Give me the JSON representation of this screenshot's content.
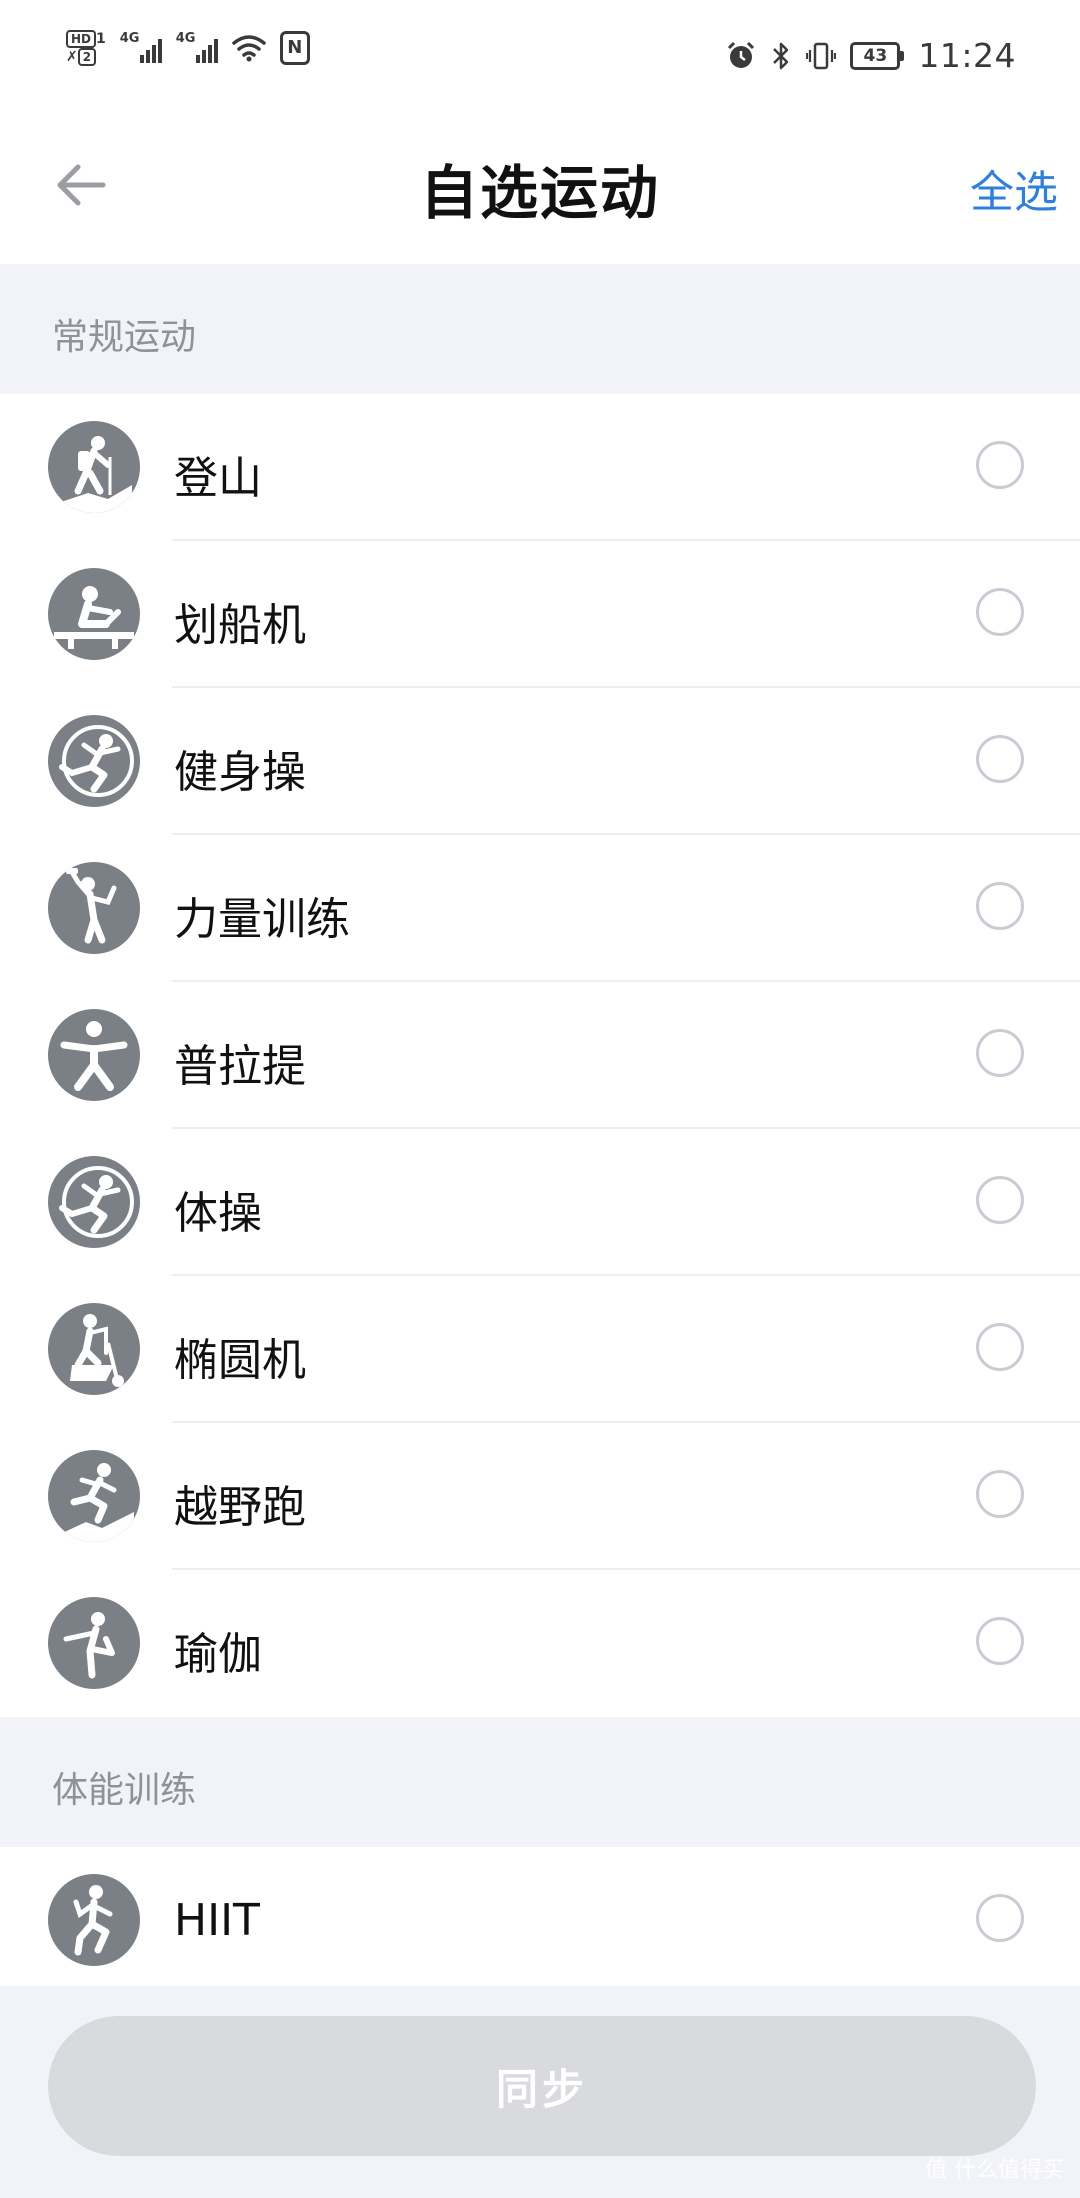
{
  "status_bar": {
    "time": "11:24",
    "battery_level": "43",
    "signal_1_tag": "4G",
    "signal_2_tag": "4G",
    "hd_label": "HD",
    "hd_slot_1": "1",
    "hd_slot_2": "2",
    "nfc_label": "N"
  },
  "app_bar": {
    "title": "自选运动",
    "select_all": "全选"
  },
  "sections": [
    {
      "header": "常规运动",
      "items": [
        {
          "label": "登山",
          "icon": "hiking-icon",
          "checked": false
        },
        {
          "label": "划船机",
          "icon": "rowing-machine-icon",
          "checked": false
        },
        {
          "label": "健身操",
          "icon": "aerobics-icon",
          "checked": false
        },
        {
          "label": "力量训练",
          "icon": "strength-training-icon",
          "checked": false
        },
        {
          "label": "普拉提",
          "icon": "pilates-icon",
          "checked": false
        },
        {
          "label": "体操",
          "icon": "gymnastics-icon",
          "checked": false
        },
        {
          "label": "椭圆机",
          "icon": "elliptical-icon",
          "checked": false
        },
        {
          "label": "越野跑",
          "icon": "trail-running-icon",
          "checked": false
        },
        {
          "label": "瑜伽",
          "icon": "yoga-icon",
          "checked": false
        }
      ]
    },
    {
      "header": "体能训练",
      "items": [
        {
          "label": "HIIT",
          "icon": "hiit-icon",
          "checked": false
        }
      ]
    }
  ],
  "sync_button": "同步",
  "watermark": "值 什么值得买",
  "colors": {
    "accent": "#2f7fdb",
    "icon_bg": "#7b8086",
    "section_bg": "#f1f3f8",
    "button_disabled": "#d8dade"
  }
}
